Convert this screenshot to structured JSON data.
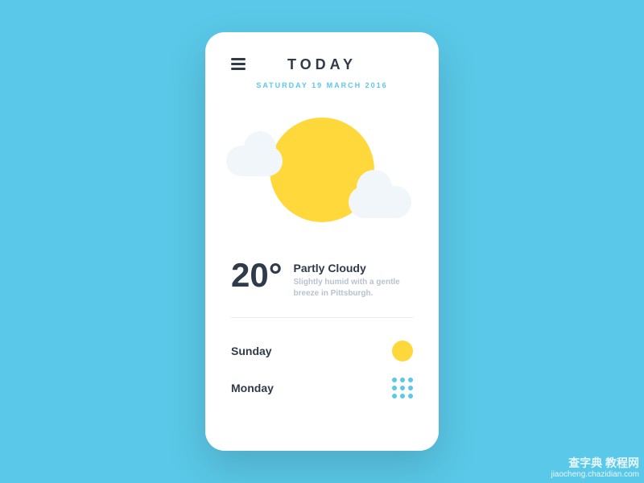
{
  "header": {
    "title": "TODAY",
    "date": "SATURDAY 19 MARCH 2016"
  },
  "current": {
    "temperature": "20°",
    "condition": "Partly Cloudy",
    "description": "Slightly humid with a gentle breeze in Pittsburgh."
  },
  "forecast": [
    {
      "day": "Sunday",
      "icon": "sunny"
    },
    {
      "day": "Monday",
      "icon": "rain"
    }
  ],
  "colors": {
    "background": "#5ac8e8",
    "accent_yellow": "#ffd93b",
    "cloud": "#f1f6fb",
    "text_dark": "#2f3a4a",
    "text_muted": "#b8c3cf"
  },
  "watermark": {
    "line1": "查字典 教程网",
    "line2": "jiaocheng.chazidian.com"
  }
}
